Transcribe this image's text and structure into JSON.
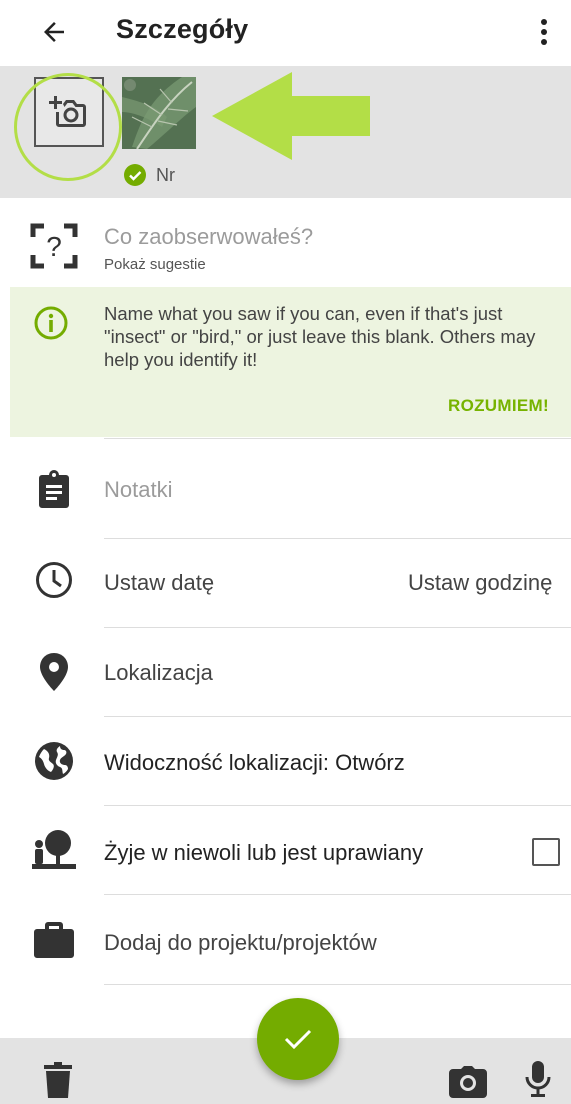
{
  "app_bar": {
    "title": "Szczegóły",
    "back_icon": "arrow-left-icon",
    "menu_icon": "more-vertical-icon"
  },
  "photos": {
    "add_icon": "add-photo-icon",
    "status_label": "Nr",
    "status_icon": "check-circle-icon"
  },
  "identification": {
    "placeholder": "Co zaobserwowałeś?",
    "suggestion_link": "Pokaż sugestie"
  },
  "tip": {
    "text": "Name what you saw if you can, even if that's just \"insect\" or \"bird,\" or just leave this blank. Others may help you identify it!",
    "confirm_button": "ROZUMIEM!"
  },
  "fields": {
    "notes_placeholder": "Notatki",
    "date_label": "Ustaw datę",
    "time_label": "Ustaw godzinę",
    "location_label": "Lokalizacja",
    "geoprivacy_label": "Widoczność lokalizacji: Otwórz",
    "captive_label": "Żyje w niewoli lub jest uprawiany",
    "captive_checked": false,
    "projects_label": "Dodaj do projektu/projektów"
  },
  "colors": {
    "accent": "#74ac00",
    "highlight": "#b3de47",
    "tip_background": "#edf4e0",
    "strip_background": "#e3e3e3"
  }
}
